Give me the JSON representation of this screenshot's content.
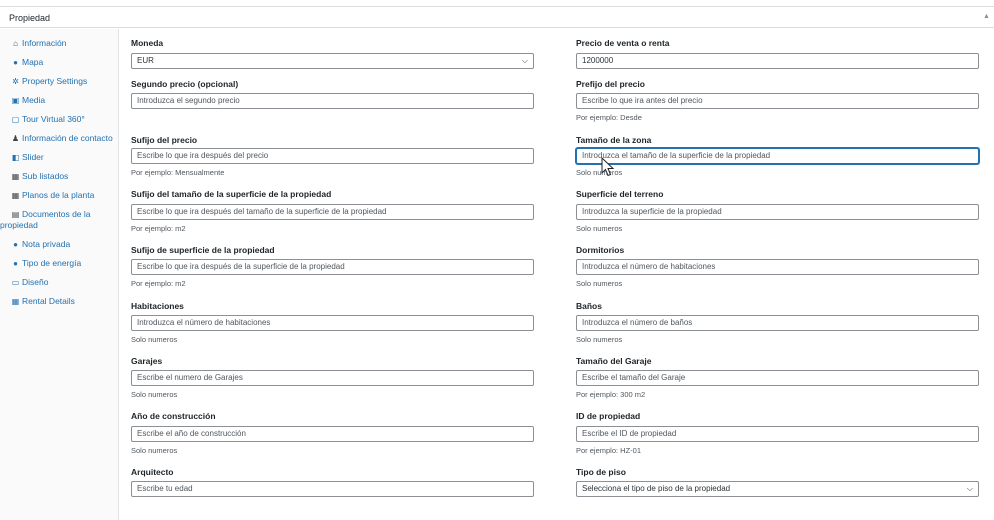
{
  "panel": {
    "title": "Propiedad",
    "toggle_icon": "caret-up-icon"
  },
  "sidebar": {
    "items": [
      {
        "label": "Información",
        "icon": "home-icon"
      },
      {
        "label": "Mapa",
        "icon": "map-pin-icon"
      },
      {
        "label": "Property Settings",
        "icon": "gear-icon"
      },
      {
        "label": "Media",
        "icon": "media-icon"
      },
      {
        "label": "Tour Virtual 360°",
        "icon": "tour-icon"
      },
      {
        "label": "Información de contacto",
        "icon": "user-icon"
      },
      {
        "label": "Slider",
        "icon": "slider-icon"
      },
      {
        "label": "Sub listados",
        "icon": "list-icon"
      },
      {
        "label": "Planos de la planta",
        "icon": "floorplan-icon"
      },
      {
        "label": "Documentos de la",
        "label2": "propiedad",
        "icon": "documents-icon"
      },
      {
        "label": "Nota privada",
        "icon": "pin-icon"
      },
      {
        "label": "Tipo de energía",
        "icon": "energy-icon"
      },
      {
        "label": "Diseño",
        "icon": "design-icon"
      },
      {
        "label": "Rental Details",
        "icon": "rental-icon"
      }
    ]
  },
  "form": {
    "moneda": {
      "label": "Moneda",
      "value": "EUR"
    },
    "precio": {
      "label": "Precio de venta o renta",
      "value": "1200000"
    },
    "segundo_precio": {
      "label": "Segundo precio (opcional)",
      "placeholder": "Introduzca el segundo precio"
    },
    "prefijo_precio": {
      "label": "Prefijo del precio",
      "placeholder": "Escribe lo que ira antes del precio",
      "help": "Por ejemplo: Desde"
    },
    "sufijo_precio": {
      "label": "Sufijo del precio",
      "placeholder": "Escribe lo que ira después del precio",
      "help": "Por ejemplo: Mensualmente"
    },
    "tamano_zona": {
      "label": "Tamaño de la zona",
      "placeholder": "Introduzca el tamaño de la superficie de la propiedad",
      "help": "Solo numeros"
    },
    "sufijo_tamano": {
      "label": "Sufijo del tamaño de la superficie de la propiedad",
      "placeholder": "Escribe lo que ira después del tamaño de la superficie de la propiedad",
      "help": "Por ejemplo: m2"
    },
    "superficie_terreno": {
      "label": "Superficie del terreno",
      "placeholder": "Introduzca la superficie de la propiedad",
      "help": "Solo numeros"
    },
    "sufijo_superficie": {
      "label": "Sufijo de superficie de la propiedad",
      "placeholder": "Escribe lo que ira después de la superficie de la propiedad",
      "help": "Por ejemplo: m2"
    },
    "dormitorios": {
      "label": "Dormitorios",
      "placeholder": "Introduzca el número de habitaciones",
      "help": "Solo numeros"
    },
    "habitaciones": {
      "label": "Habitaciones",
      "placeholder": "Introduzca el número de habitaciones",
      "help": "Solo numeros"
    },
    "banos": {
      "label": "Baños",
      "placeholder": "Introduzca el número de baños",
      "help": "Solo numeros"
    },
    "garajes": {
      "label": "Garajes",
      "placeholder": "Escribe el numero de Garajes",
      "help": "Solo numeros"
    },
    "tamano_garaje": {
      "label": "Tamaño del Garaje",
      "placeholder": "Escribe el tamaño del Garaje",
      "help": "Por ejemplo: 300 m2"
    },
    "ano_construccion": {
      "label": "Año de construcción",
      "placeholder": "Escribe el año de construcción",
      "help": "Solo numeros"
    },
    "id_propiedad": {
      "label": "ID de propiedad",
      "placeholder": "Escribe el ID de propiedad",
      "help": "Por ejemplo: HZ-01"
    },
    "arquitecto": {
      "label": "Arquitecto",
      "placeholder": "Escribe tu edad"
    },
    "tipo_piso": {
      "label": "Tipo de piso",
      "value": "Selecciona el tipo de piso de la propiedad"
    }
  },
  "colors": {
    "accent": "#2271b1",
    "text": "#1d2327",
    "muted": "#50575e",
    "border": "#8c8f94"
  }
}
